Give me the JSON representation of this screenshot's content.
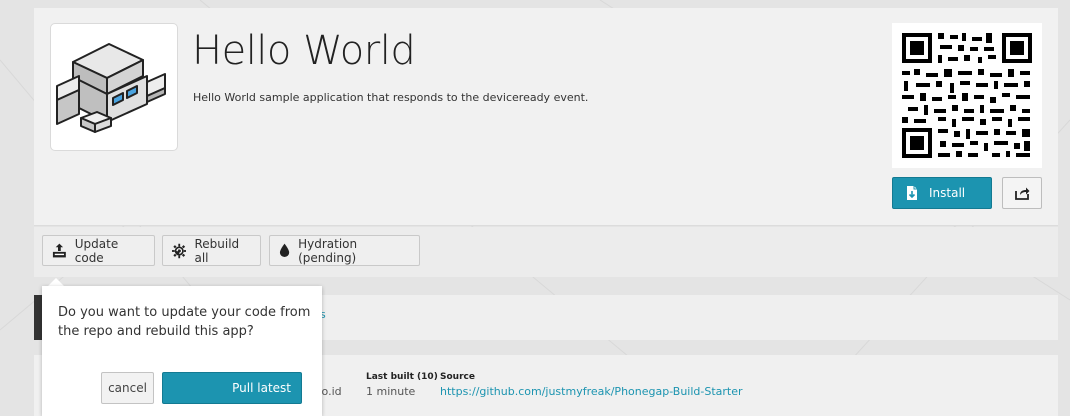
{
  "app": {
    "title": "Hello World",
    "description": "Hello World sample application that responds to the deviceready event."
  },
  "actions": {
    "install_label": "Install"
  },
  "toolbar": {
    "update_code_label": "Update code",
    "rebuild_all_label": "Rebuild all",
    "hydration_label": "Hydration (pending)"
  },
  "tabs": {
    "partial_label": "s"
  },
  "info": {
    "owner_partial": ".co.id",
    "last_built_label": "Last built (10)",
    "last_built_value": "1 minute",
    "source_label": "Source",
    "source_value": "https://github.com/justmyfreak/Phonegap-Build-Starter"
  },
  "popover": {
    "message": "Do you want to update your code from the repo and rebuild this app?",
    "cancel_label": "cancel",
    "pull_label": "Pull latest"
  },
  "colors": {
    "accent": "#1c94b0",
    "background": "#e4e4e4"
  },
  "icons": [
    "robot-app-icon",
    "qr-code-icon",
    "install-icon",
    "share-icon",
    "update-code-icon",
    "rebuild-gear-icon",
    "hydration-drop-icon"
  ]
}
